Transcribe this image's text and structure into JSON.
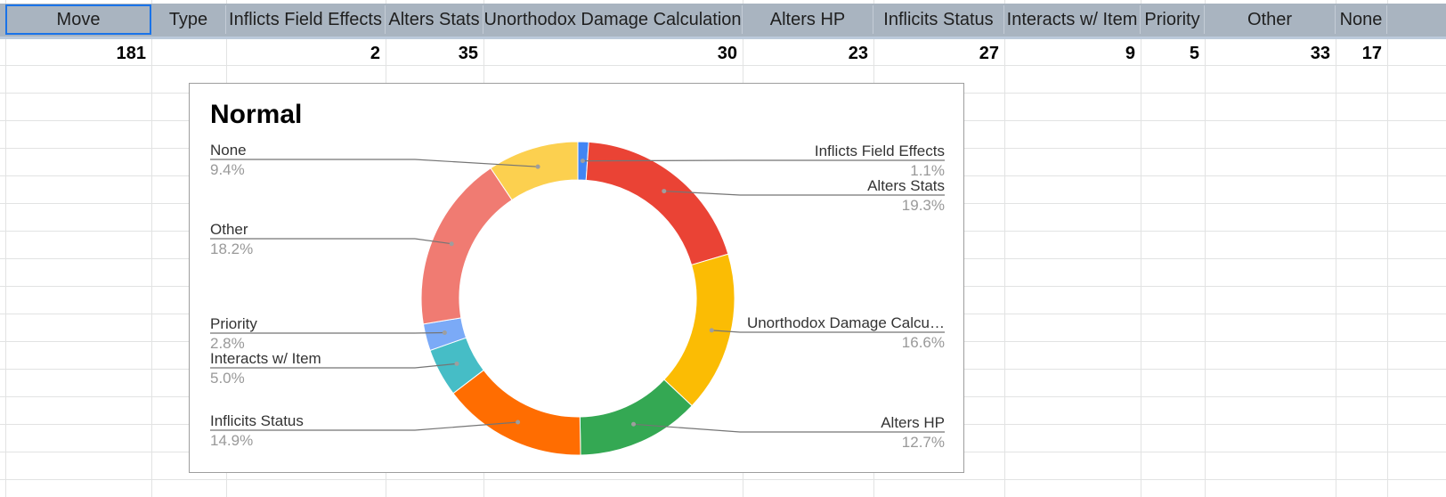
{
  "sheet": {
    "headers": [
      "Move",
      "Type",
      "Inflicts Field Effects",
      "Alters Stats",
      "Unorthodox Damage Calculation",
      "Alters HP",
      "Inflicits Status",
      "Interacts w/ Item",
      "Priority",
      "Other",
      "None"
    ],
    "values": [
      "181",
      "",
      "2",
      "35",
      "30",
      "23",
      "27",
      "9",
      "5",
      "33",
      "17"
    ],
    "header_fill": "#a9b4c0",
    "selection_color": "#1a73e8"
  },
  "chart_data": {
    "type": "pie",
    "donut": true,
    "title": "Normal",
    "slices": [
      {
        "label": "Inflicts Field Effects",
        "value": 2,
        "percent_label": "1.1%",
        "color": "#4285f4"
      },
      {
        "label": "Alters Stats",
        "value": 35,
        "percent_label": "19.3%",
        "color": "#ea4335"
      },
      {
        "label": "Unorthodox Damage Calcu…",
        "value": 30,
        "percent_label": "16.6%",
        "color": "#fbbc04"
      },
      {
        "label": "Alters HP",
        "value": 23,
        "percent_label": "12.7%",
        "color": "#34a853"
      },
      {
        "label": "Inflicits Status",
        "value": 27,
        "percent_label": "14.9%",
        "color": "#ff6d01"
      },
      {
        "label": "Interacts w/ Item",
        "value": 9,
        "percent_label": "5.0%",
        "color": "#46bdc6"
      },
      {
        "label": "Priority",
        "value": 5,
        "percent_label": "2.8%",
        "color": "#7baaf7"
      },
      {
        "label": "Other",
        "value": 33,
        "percent_label": "18.2%",
        "color": "#f07b72"
      },
      {
        "label": "None",
        "value": 17,
        "percent_label": "9.4%",
        "color": "#fcd04f"
      }
    ],
    "legend": "labels with leader lines on both sides"
  }
}
